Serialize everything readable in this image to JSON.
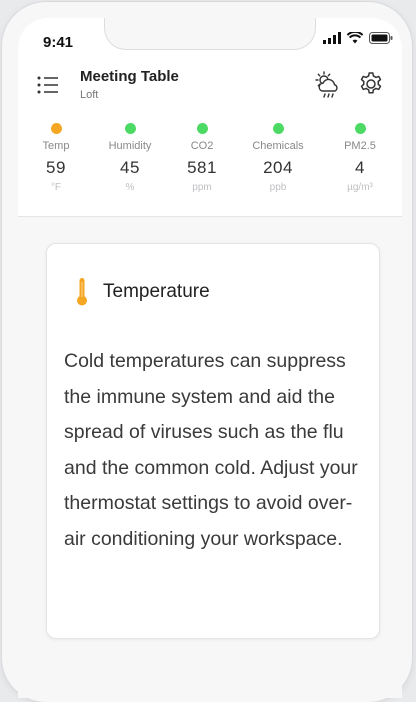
{
  "status_bar": {
    "time": "9:41"
  },
  "header": {
    "title": "Meeting Table",
    "subtitle": "Loft"
  },
  "metrics": [
    {
      "label": "Temp",
      "value": "59",
      "unit": "°F",
      "status_color": "#F5A623"
    },
    {
      "label": "Humidity",
      "value": "45",
      "unit": "%",
      "status_color": "#4CD964"
    },
    {
      "label": "CO2",
      "value": "581",
      "unit": "ppm",
      "status_color": "#4CD964"
    },
    {
      "label": "Chemicals",
      "value": "204",
      "unit": "ppb",
      "status_color": "#4CD964"
    },
    {
      "label": "PM2.5",
      "value": "4",
      "unit": "µg/m³",
      "status_color": "#4CD964"
    }
  ],
  "card": {
    "title": "Temperature",
    "icon_color": "#F5A623",
    "body": "Cold temperatures can suppress the immune system and aid the spread of viruses such as the flu and the common cold. Adjust your thermostat settings to avoid over-air conditioning your workspace."
  },
  "icons": {
    "menu": "list-menu-icon",
    "weather": "weather-cloud-sun-icon",
    "settings": "gear-icon",
    "temperature": "thermometer-icon"
  }
}
